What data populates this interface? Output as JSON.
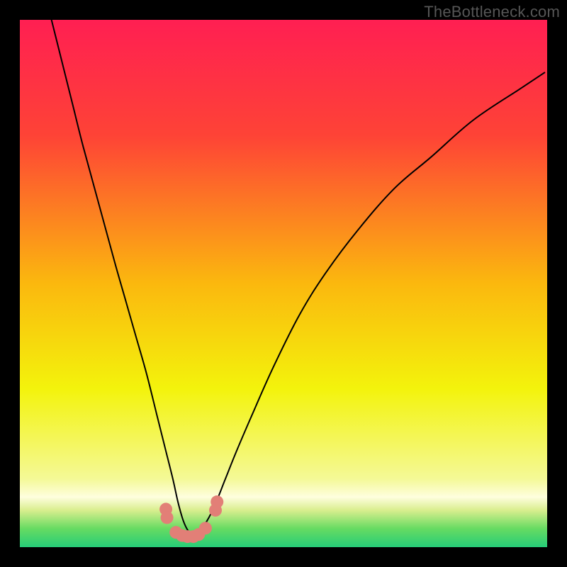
{
  "watermark": "TheBottleneck.com",
  "chart_data": {
    "type": "line",
    "title": "",
    "xlabel": "",
    "ylabel": "",
    "xlim": [
      0,
      100
    ],
    "ylim": [
      0,
      100
    ],
    "background_gradient": {
      "stops": [
        {
          "offset": 0.0,
          "color": "#ff1f52"
        },
        {
          "offset": 0.22,
          "color": "#fe4336"
        },
        {
          "offset": 0.5,
          "color": "#fbb80e"
        },
        {
          "offset": 0.7,
          "color": "#f3f30c"
        },
        {
          "offset": 0.87,
          "color": "#f4f996"
        },
        {
          "offset": 0.905,
          "color": "#fefede"
        },
        {
          "offset": 0.93,
          "color": "#d9ee8e"
        },
        {
          "offset": 0.965,
          "color": "#66db62"
        },
        {
          "offset": 1.0,
          "color": "#26cd78"
        }
      ]
    },
    "series": [
      {
        "name": "curve",
        "color": "#000000",
        "stroke_width": 2,
        "x": [
          6,
          8,
          10,
          12,
          15,
          18,
          20,
          22,
          24,
          26,
          27.5,
          29,
          30,
          31,
          32,
          33,
          34,
          35.5,
          37,
          39,
          41,
          44,
          48,
          53,
          58,
          64,
          71,
          78,
          86,
          95,
          99.5
        ],
        "y": [
          100,
          92,
          84,
          76,
          65,
          54,
          47,
          40,
          33,
          25,
          19,
          13,
          8.5,
          5,
          3,
          2.5,
          3,
          5,
          8,
          13,
          18,
          25,
          34,
          44,
          52,
          60,
          68,
          74,
          81,
          87,
          90
        ]
      },
      {
        "name": "bottom-markers",
        "type": "scatter",
        "color": "#e27f77",
        "marker_radius": 9,
        "x": [
          27.7,
          27.9,
          29.6,
          30.8,
          31.8,
          32.9,
          33.9,
          35.2,
          37.1,
          37.4
        ],
        "y": [
          7.2,
          5.6,
          2.8,
          2.2,
          2.0,
          2.0,
          2.4,
          3.6,
          7.0,
          8.6
        ]
      }
    ]
  }
}
